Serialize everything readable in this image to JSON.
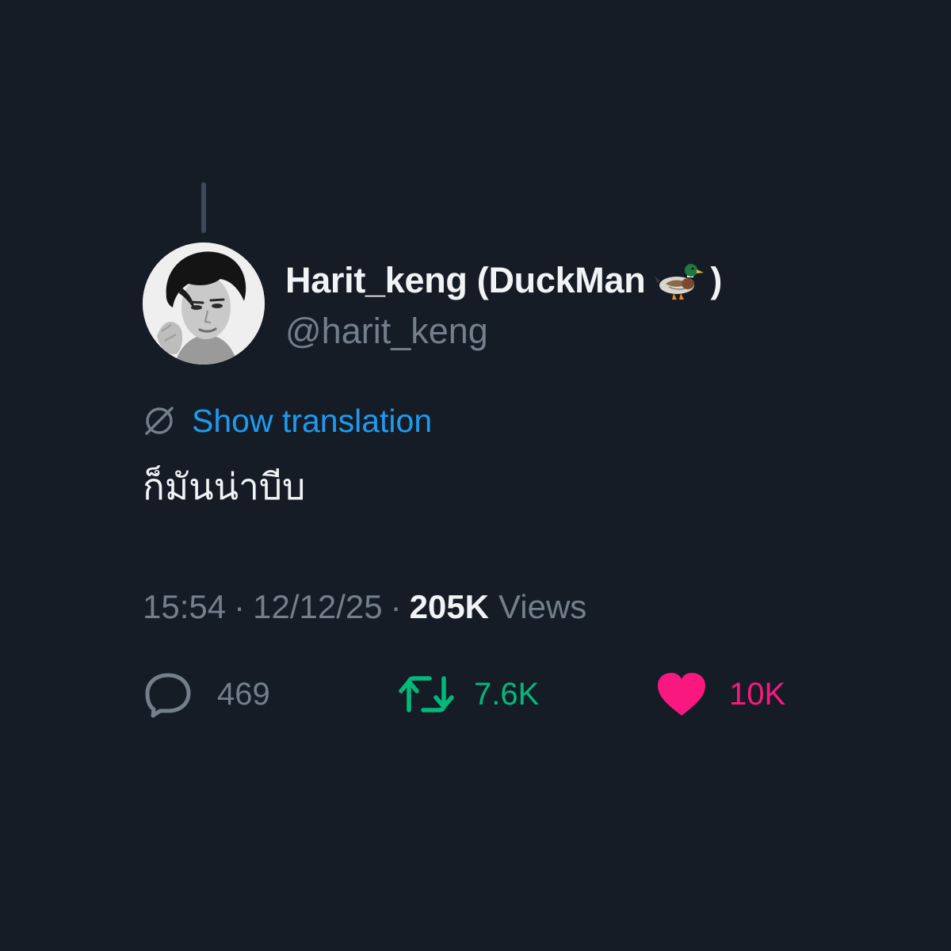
{
  "tweet": {
    "author": {
      "display_name": "Harit_keng (DuckMan",
      "display_name_emoji": "duck-emoji",
      "display_name_suffix": ")",
      "handle": "@harit_keng"
    },
    "translate_label": "Show translation",
    "text": "ก็มันน่าบีบ",
    "time": "15:54",
    "date": "12/12/25",
    "separator": "·",
    "views_count": "205K",
    "views_label": "Views",
    "stats": {
      "replies": "469",
      "retweets": "7.6K",
      "likes": "10K"
    }
  },
  "icons": {
    "translate": "globe-icon",
    "reply": "reply-bubble-icon",
    "retweet": "retweet-icon",
    "like": "heart-filled-icon"
  },
  "colors": {
    "background": "#151c26",
    "primary_text": "#f2f3f4",
    "secondary_text": "#737f8b",
    "link": "#1d9bf0",
    "retweet": "#00ba7c",
    "like": "#f91880"
  }
}
